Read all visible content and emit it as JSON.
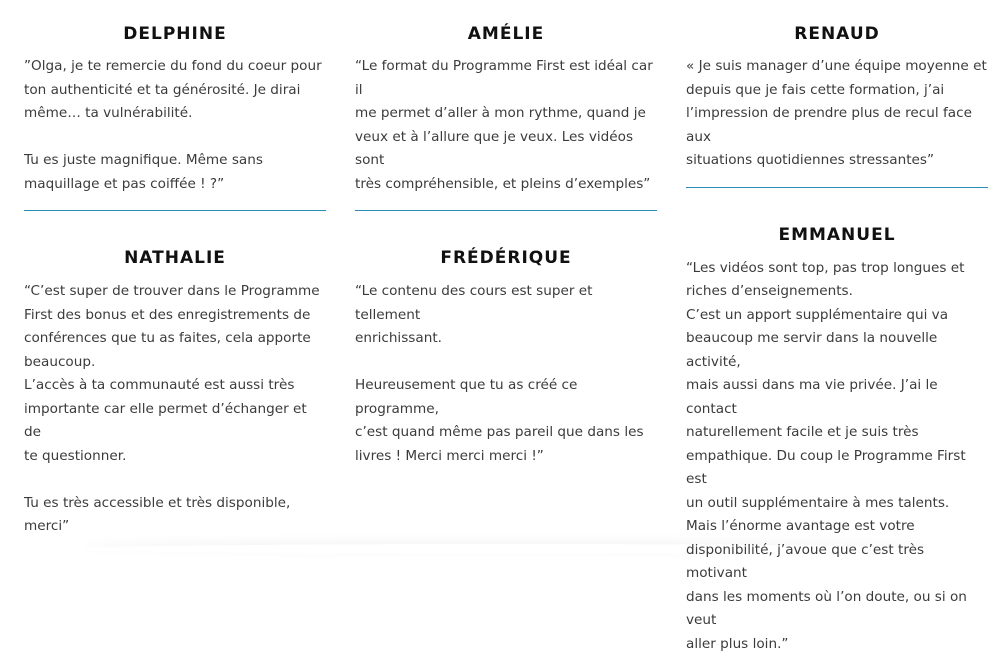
{
  "testimonials": {
    "delphine": {
      "name": "DELPHINE",
      "lines": [
        "”Olga, je te remercie du fond du coeur pour",
        "ton authenticité et ta générosité. Je dirai",
        "même… ta vulnérabilité.",
        "",
        "Tu es juste magnifique. Même sans",
        "maquillage et pas coiffée ! ?”"
      ]
    },
    "nathalie": {
      "name": "NATHALIE",
      "lines": [
        "“C’est super de trouver dans le Programme",
        "First des bonus et des enregistrements de",
        "conférences que tu as faites, cela apporte",
        "beaucoup.",
        "L’accès à ta communauté est aussi très",
        "importante car elle permet d’échanger et de",
        "te questionner.",
        "",
        "Tu es très accessible et très disponible, merci”"
      ]
    },
    "amelie": {
      "name": "AMÉLIE",
      "lines": [
        "“Le format du Programme First est idéal car il",
        "me permet d’aller à mon rythme, quand je",
        "veux et à l’allure que je veux. Les vidéos sont",
        "très compréhensible, et pleins d’exemples”"
      ]
    },
    "frederique": {
      "name": "FRÉDÉRIQUE",
      "lines": [
        "“Le contenu des cours est super et tellement",
        "enrichissant.",
        "",
        "Heureusement que tu as créé ce programme,",
        "c’est quand même pas pareil que dans les",
        "livres ! Merci merci merci !”"
      ]
    },
    "renaud": {
      "name": "RENAUD",
      "lines": [
        "« Je suis manager d’une équipe moyenne et",
        "depuis que je fais cette formation, j’ai",
        "l’impression de prendre plus de recul face aux",
        "situations quotidiennes stressantes”"
      ]
    },
    "emmanuel": {
      "name": "EMMANUEL",
      "lines": [
        "“Les vidéos sont top, pas trop longues et",
        "riches d’enseignements.",
        "C’est un apport supplémentaire qui va",
        "beaucoup me servir dans la nouvelle activité,",
        "mais aussi dans ma vie privée. J’ai le contact",
        "naturellement facile et je suis très",
        "empathique. Du coup le Programme First est",
        "un outil supplémentaire à mes talents.",
        "Mais l’énorme avantage est votre",
        "disponibilité, j’avoue que c’est très motivant",
        "dans les moments où l’on doute, ou si on veut",
        "aller plus loin.”"
      ]
    }
  },
  "colors": {
    "divider": "#2a8fb8",
    "heading": "#111111",
    "text": "#3b3b3b"
  }
}
